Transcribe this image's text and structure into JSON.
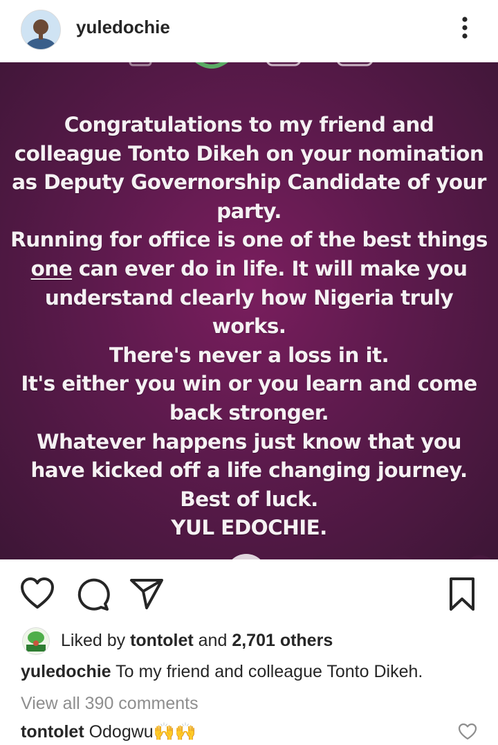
{
  "header": {
    "username": "yuledochie",
    "more_icon": "more-vertical-icon"
  },
  "post": {
    "lines": [
      "Congratulations to my friend and",
      "colleague Tonto Dikeh on your nomination",
      "as Deputy Governorship Candidate of your",
      "party.",
      "Running for office is one of the best things",
      "one",
      " can ever do in life. It will make you",
      "understand clearly how Nigeria truly",
      "works.",
      "There's never a loss in it.",
      "It's either you win or you learn and come",
      "back stronger.",
      "Whatever happens just know that you",
      "have kicked off a life changing journey.",
      "Best of luck.",
      "YUL EDOCHIE."
    ]
  },
  "actions": {
    "like_icon": "heart-icon",
    "comment_icon": "comment-icon",
    "share_icon": "share-icon",
    "save_icon": "bookmark-icon"
  },
  "likes": {
    "prefix": "Liked by ",
    "user": "tontolet",
    "middle": " and ",
    "count": "2,701 others"
  },
  "caption": {
    "user": "yuledochie",
    "text": " To my friend and colleague Tonto Dikeh."
  },
  "view_all": "View all 390 comments",
  "comment": {
    "user": "tontolet",
    "text": " Odogwu",
    "emoji": "🙌🙌"
  },
  "colors": {
    "post_background": "#5c1a4c",
    "post_text": "#f5f1f3",
    "muted_text": "#8e8e8e"
  }
}
